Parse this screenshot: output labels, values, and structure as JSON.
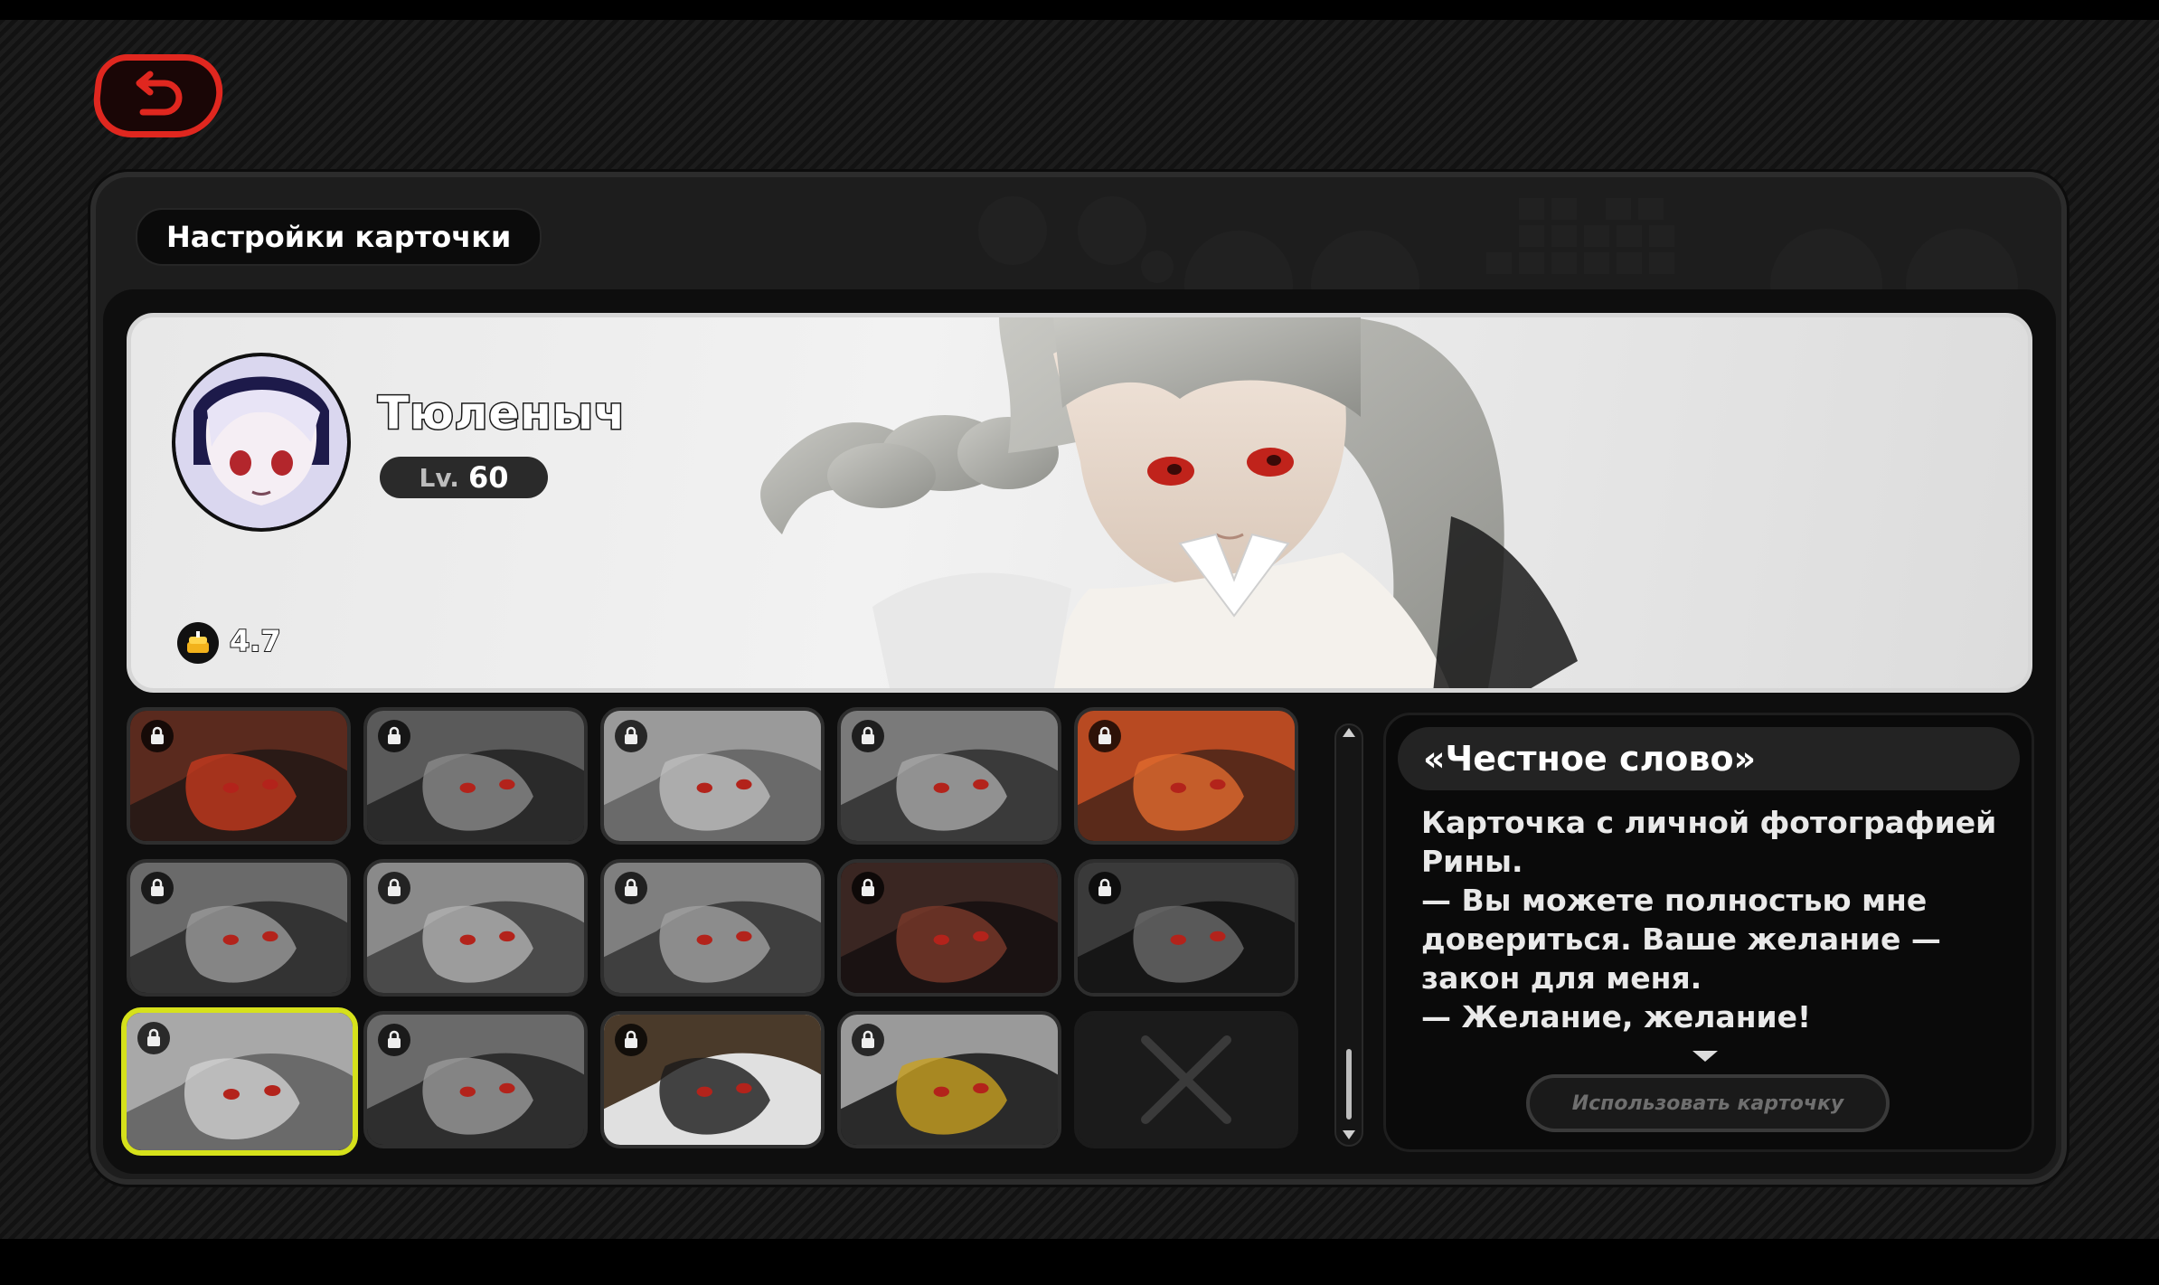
{
  "header": {
    "back_label": "",
    "title": "Настройки карточки"
  },
  "profile": {
    "name": "Тюленыч",
    "level_prefix": "Lv.",
    "level": "60",
    "badge_value": "4.7"
  },
  "cards": [
    {
      "state": "locked",
      "palette": [
        "#5a2a1e",
        "#2a1a16",
        "#c43a1e"
      ]
    },
    {
      "state": "locked",
      "palette": [
        "#5a5a5a",
        "#2a2a2a",
        "#8a8a8a"
      ]
    },
    {
      "state": "locked",
      "palette": [
        "#9a9a9a",
        "#6a6a6a",
        "#bdbdbd"
      ]
    },
    {
      "state": "locked",
      "palette": [
        "#7a7a7a",
        "#3a3a3a",
        "#a8a8a8"
      ]
    },
    {
      "state": "locked",
      "palette": [
        "#b84a22",
        "#5a2a1a",
        "#e06a2e"
      ]
    },
    {
      "state": "locked",
      "palette": [
        "#6a6a6a",
        "#333333",
        "#9a9a9a"
      ]
    },
    {
      "state": "locked",
      "palette": [
        "#8a8a8a",
        "#4a4a4a",
        "#b0b0b0"
      ]
    },
    {
      "state": "locked",
      "palette": [
        "#7f7f7f",
        "#3f3f3f",
        "#a0a0a0"
      ]
    },
    {
      "state": "locked",
      "palette": [
        "#3a2622",
        "#1a1212",
        "#7a3a2a"
      ]
    },
    {
      "state": "locked",
      "palette": [
        "#3a3a3a",
        "#161616",
        "#6a6a6a"
      ]
    },
    {
      "state": "selected",
      "palette": [
        "#a8a8a8",
        "#6a6a6a",
        "#d0d0d0"
      ]
    },
    {
      "state": "locked",
      "palette": [
        "#6a6a6a",
        "#2e2e2e",
        "#9a9a9a"
      ]
    },
    {
      "state": "locked",
      "palette": [
        "#4a3a2a",
        "#e0e0e0",
        "#1a1a1a"
      ]
    },
    {
      "state": "locked",
      "palette": [
        "#9a9a9a",
        "#2a2a2a",
        "#c8a020"
      ]
    },
    {
      "state": "empty",
      "palette": [
        "#1b1b1b",
        "#1b1b1b",
        "#1b1b1b"
      ]
    }
  ],
  "detail": {
    "title": "«Честное слово»",
    "lines": [
      "Карточка с личной фотографией Рины.",
      "— Вы можете полностью мне довериться. Ваше желание — закон для меня.",
      "— Желание, желание!"
    ],
    "use_button": "Использовать карточку"
  },
  "colors": {
    "accent_red": "#e0271f",
    "selected_outline": "#d6e11b"
  }
}
